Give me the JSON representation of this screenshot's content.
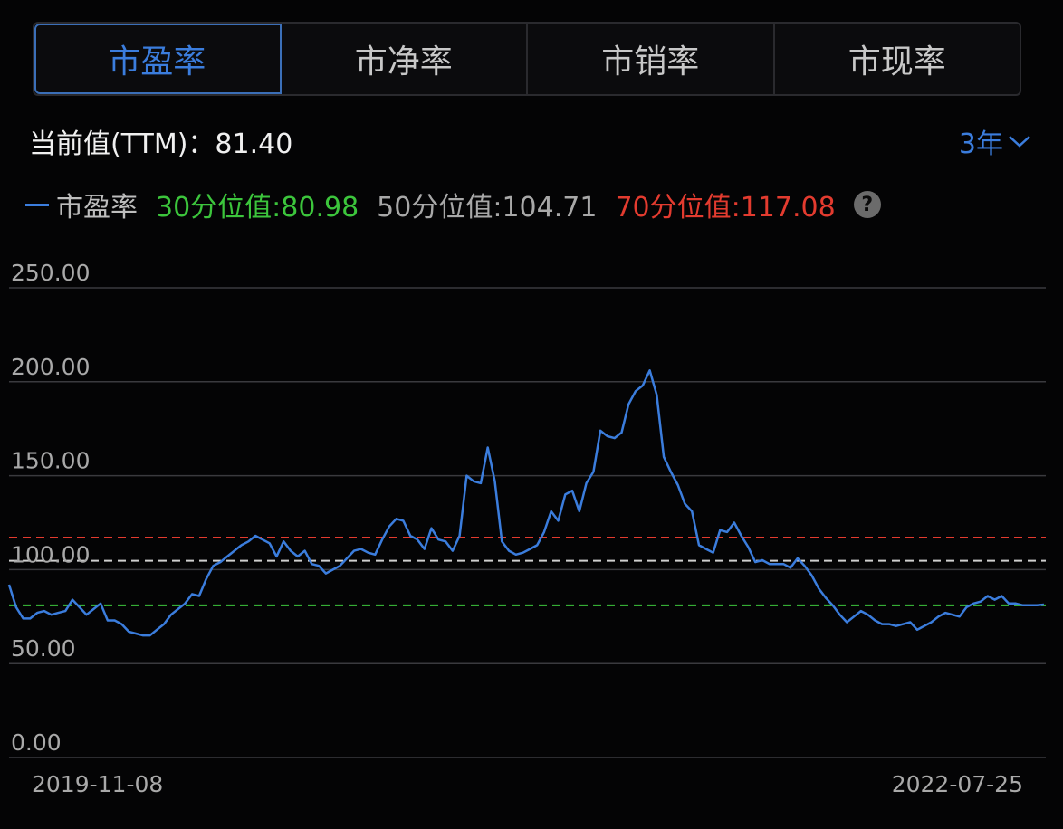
{
  "tabs": [
    {
      "label": "市盈率",
      "active": true
    },
    {
      "label": "市净率",
      "active": false
    },
    {
      "label": "市销率",
      "active": false
    },
    {
      "label": "市现率",
      "active": false
    }
  ],
  "current": {
    "label": "当前值(TTM)：",
    "value": "81.40"
  },
  "range": {
    "label": "3年"
  },
  "legend": {
    "series_label": "市盈率",
    "p30": "30分位值:80.98",
    "p50": "50分位值:104.71",
    "p70": "70分位值:117.08"
  },
  "colors": {
    "line": "#3b7ddd",
    "p30": "#3cc53c",
    "p50": "#cfcfcf",
    "p70": "#e33b2f",
    "grid": "#3a3a3e"
  },
  "chart_data": {
    "type": "line",
    "yticks": [
      "250.00",
      "200.00",
      "150.00",
      "100.00",
      "50.00",
      "0.00"
    ],
    "ylim": [
      0,
      250
    ],
    "x_start": "2019-11-08",
    "x_end": "2022-07-25",
    "reference_lines": [
      {
        "name": "30分位值",
        "value": 80.98,
        "color": "#3cc53c"
      },
      {
        "name": "50分位值",
        "value": 104.71,
        "color": "#cfcfcf"
      },
      {
        "name": "70分位值",
        "value": 117.08,
        "color": "#e33b2f"
      }
    ],
    "series": [
      {
        "values": [
          92,
          80,
          74,
          74,
          77,
          78,
          76,
          77,
          78,
          84,
          80,
          76,
          79,
          82,
          73,
          73,
          71,
          67,
          66,
          65,
          65,
          68,
          71,
          76,
          79,
          82,
          87,
          86,
          95,
          102,
          104,
          107,
          110,
          113,
          115,
          118,
          116,
          114,
          107,
          115,
          110,
          107,
          110,
          103,
          102,
          98,
          100,
          102,
          106,
          110,
          111,
          109,
          108,
          116,
          123,
          127,
          126,
          118,
          116,
          111,
          122,
          116,
          115,
          110,
          118,
          150,
          147,
          146,
          165,
          147,
          115,
          110,
          108,
          109,
          111,
          113,
          120,
          131,
          126,
          140,
          142,
          131,
          146,
          152,
          174,
          171,
          170,
          173,
          188,
          195,
          198,
          206,
          193,
          160,
          152,
          145,
          135,
          131,
          113,
          111,
          109,
          121,
          120,
          125,
          118,
          112,
          104,
          105,
          103,
          103,
          103,
          101,
          106,
          102,
          97,
          90,
          85,
          81,
          76,
          72,
          75,
          78,
          76,
          73,
          71,
          71,
          70,
          71,
          72,
          68,
          70,
          72,
          75,
          77,
          76,
          75,
          80,
          82,
          83,
          86,
          84,
          86,
          82,
          82,
          81,
          81,
          81,
          81.4
        ]
      }
    ]
  }
}
